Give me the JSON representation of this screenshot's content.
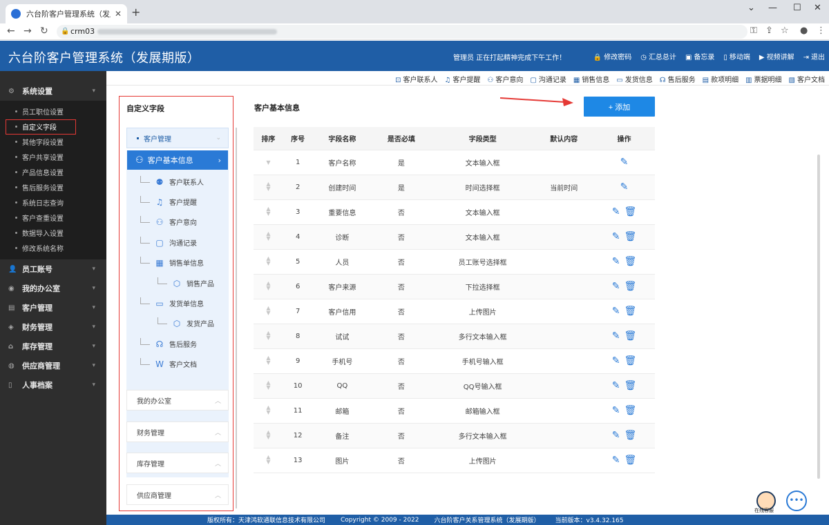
{
  "browser": {
    "tab_title": "六台阶客户管理系统（发展期版）",
    "url_visible": "crm03"
  },
  "header": {
    "title": "六台阶客户管理系统（发展期版）",
    "message": "管理员 正在打起精神完成下午工作！",
    "links": [
      {
        "label": "修改密码",
        "icon": "lock-icon"
      },
      {
        "label": "汇总总计",
        "icon": "clock-icon"
      },
      {
        "label": "备忘录",
        "icon": "book-icon"
      },
      {
        "label": "移动端",
        "icon": "mobile-icon"
      },
      {
        "label": "视频讲解",
        "icon": "video-icon"
      },
      {
        "label": "退出",
        "icon": "logout-icon"
      }
    ]
  },
  "sidebar": {
    "system_settings": "系统设置",
    "system_items": [
      "员工职位设置",
      "自定义字段",
      "其他字段设置",
      "客户共享设置",
      "产品信息设置",
      "售后服务设置",
      "系统日志查询",
      "客户查重设置",
      "数据导入设置",
      "修改系统名称"
    ],
    "groups": [
      "员工账号",
      "我的办公室",
      "客户管理",
      "财务管理",
      "库存管理",
      "供应商管理",
      "人事档案"
    ]
  },
  "toolbar2": [
    "客户联系人",
    "客户提醒",
    "客户意向",
    "沟通记录",
    "销售信息",
    "发货信息",
    "售后服务",
    "款项明细",
    "票据明细",
    "客户文档"
  ],
  "left_panel": {
    "title": "自定义字段",
    "open_group": "客户管理",
    "active_node": "客户基本信息",
    "nodes": [
      "客户联系人",
      "客户提醒",
      "客户意向",
      "沟通记录",
      "销售单信息",
      "销售产品",
      "发货单信息",
      "发货产品",
      "售后服务",
      "客户文档"
    ],
    "collapsed_groups": [
      "我的办公室",
      "财务管理",
      "库存管理",
      "供应商管理"
    ]
  },
  "main": {
    "title": "客户基本信息",
    "add_label": "+ 添加",
    "columns": [
      "排序",
      "序号",
      "字段名称",
      "是否必填",
      "字段类型",
      "默认内容",
      "操作"
    ],
    "rows": [
      [
        "1",
        "客户名称",
        "是",
        "文本输入框",
        ""
      ],
      [
        "2",
        "创建时间",
        "是",
        "时间选择框",
        "当前时间"
      ],
      [
        "3",
        "重要信息",
        "否",
        "文本输入框",
        ""
      ],
      [
        "4",
        "诊断",
        "否",
        "文本输入框",
        ""
      ],
      [
        "5",
        "人员",
        "否",
        "员工账号选择框",
        ""
      ],
      [
        "6",
        "客户来源",
        "否",
        "下拉选择框",
        ""
      ],
      [
        "7",
        "客户信用",
        "否",
        "上传图片",
        ""
      ],
      [
        "8",
        "试试",
        "否",
        "多行文本输入框",
        ""
      ],
      [
        "9",
        "手机号",
        "否",
        "手机号输入框",
        ""
      ],
      [
        "10",
        "QQ",
        "否",
        "QQ号输入框",
        ""
      ],
      [
        "11",
        "邮箱",
        "否",
        "邮箱输入框",
        ""
      ],
      [
        "12",
        "备注",
        "否",
        "多行文本输入框",
        ""
      ],
      [
        "13",
        "图片",
        "否",
        "上传图片",
        ""
      ]
    ]
  },
  "footer": {
    "copyright_owner": "版权所有：天津鸿软通联信息技术有限公司",
    "copyright": "Copyright © 2009 - 2022",
    "system": "六台阶客户关系管理系统（发展期版）",
    "version": "当前版本：v3.4.32.165"
  },
  "float": {
    "cs_label": "在线客服"
  }
}
